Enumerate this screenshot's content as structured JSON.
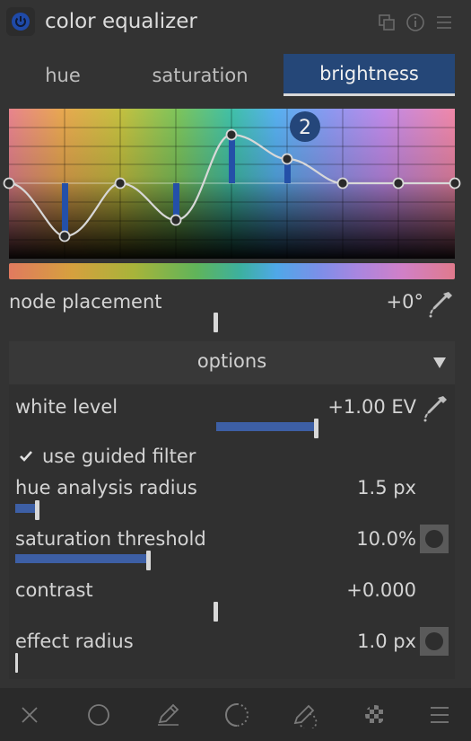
{
  "module": {
    "title": "color equalizer"
  },
  "tabs": [
    {
      "label": "hue",
      "active": false
    },
    {
      "label": "saturation",
      "active": false
    },
    {
      "label": "brightness",
      "active": true
    }
  ],
  "graph": {
    "selected_node_badge": "2"
  },
  "node_placement": {
    "label": "node placement",
    "value": "+0°",
    "level": 0.5
  },
  "options": {
    "header": "options",
    "white_level": {
      "label": "white level",
      "value": "+1.00 EV"
    },
    "guided_filter": {
      "label": "use guided filter",
      "checked": true
    },
    "hue_analysis_radius": {
      "label": "hue analysis radius",
      "value": "1.5 px"
    },
    "saturation_threshold": {
      "label": "saturation threshold",
      "value": "10.0%"
    },
    "contrast": {
      "label": "contrast",
      "value": "+0.000"
    },
    "effect_radius": {
      "label": "effect radius",
      "value": "1.0 px"
    }
  },
  "bottom_bar": {
    "icons": [
      "close-icon",
      "circle-icon",
      "pencil-icon",
      "dotted-circle-icon",
      "pencil-dotted-icon",
      "checker-icon",
      "menu-icon"
    ]
  },
  "colors": {
    "accent": "#254778",
    "fill": "#3d5fa5",
    "background": "#333333"
  }
}
